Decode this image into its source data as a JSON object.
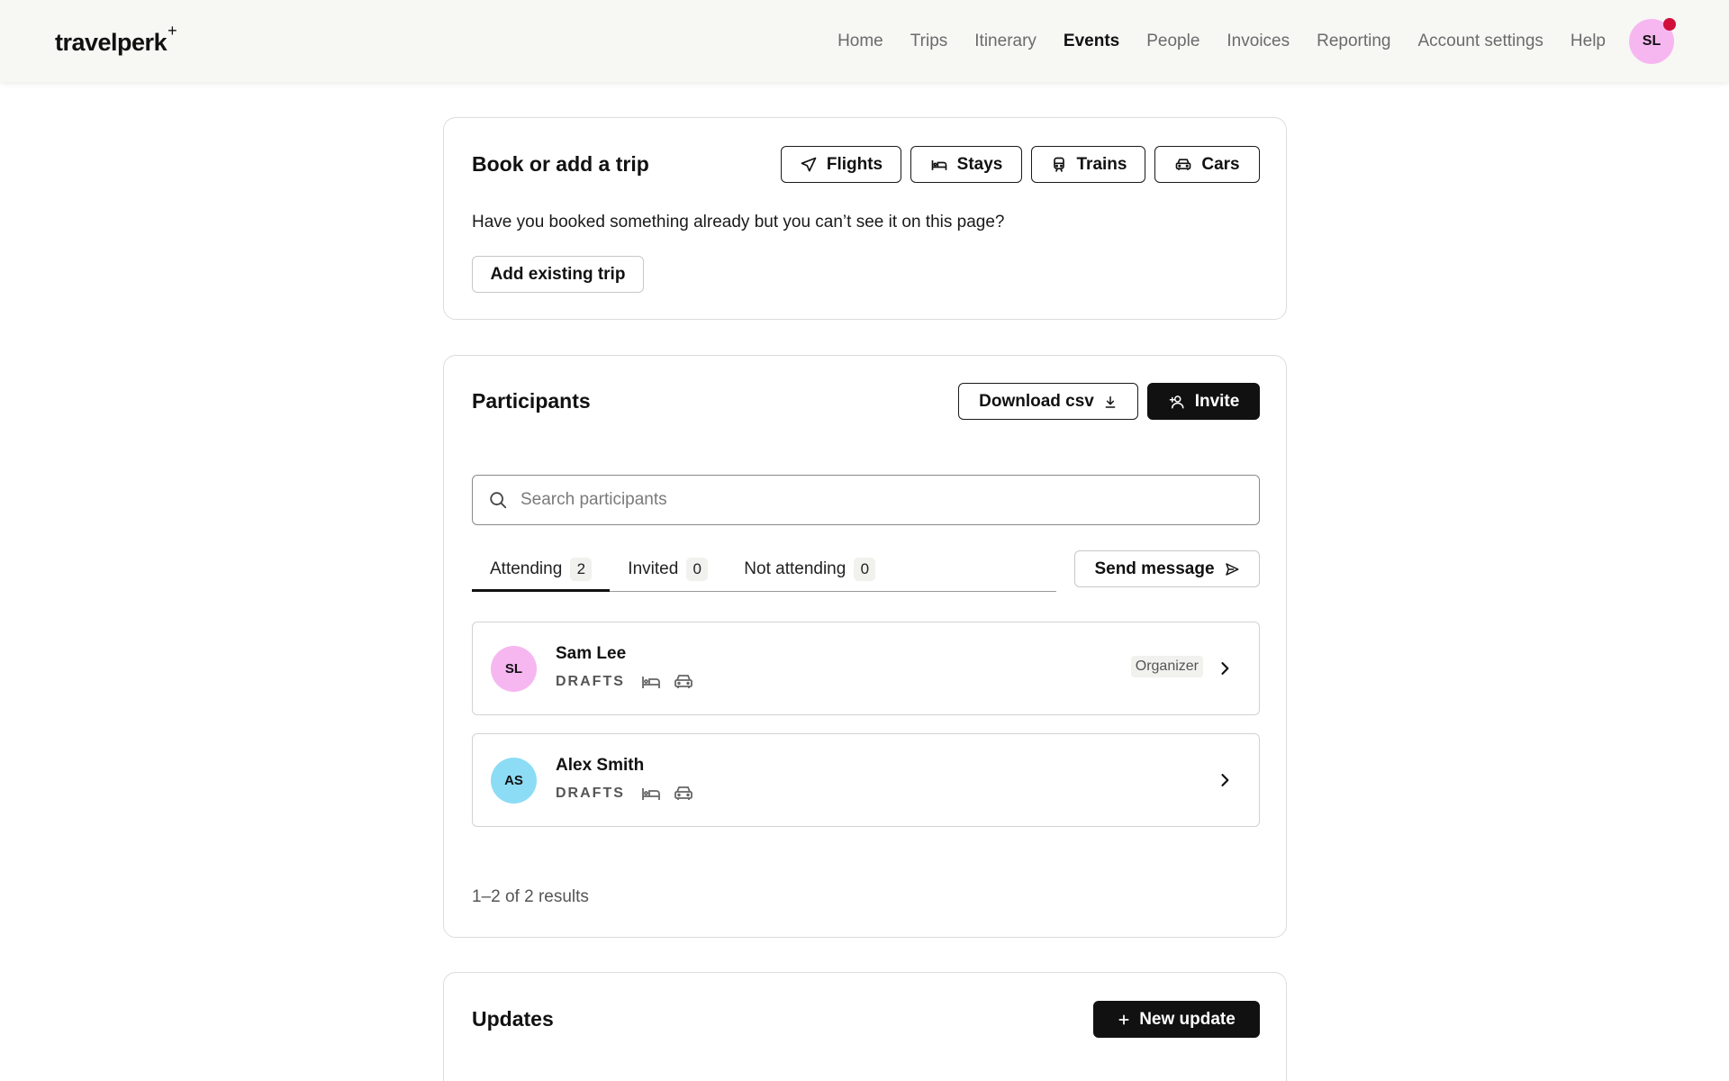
{
  "brand": {
    "name": "travelperk",
    "mark": "+"
  },
  "nav": {
    "items": [
      "Home",
      "Trips",
      "Itinerary",
      "Events",
      "People",
      "Invoices",
      "Reporting",
      "Account settings",
      "Help"
    ],
    "active": "Events",
    "user_initials": "SL"
  },
  "book": {
    "title": "Book or add a trip",
    "buttons": {
      "flights": "Flights",
      "stays": "Stays",
      "trains": "Trains",
      "cars": "Cars"
    },
    "prompt": "Have you booked something already but you can’t see it on this page?",
    "add_existing": "Add existing trip"
  },
  "participants": {
    "title": "Participants",
    "download_csv": "Download csv",
    "invite": "Invite",
    "search_placeholder": "Search participants",
    "tabs": [
      {
        "label": "Attending",
        "count": "2"
      },
      {
        "label": "Invited",
        "count": "0"
      },
      {
        "label": "Not attending",
        "count": "0"
      }
    ],
    "send_message": "Send message",
    "rows": [
      {
        "initials": "SL",
        "name": "Sam Lee",
        "status": "DRAFTS",
        "badge": "Organizer",
        "avatar_color": "#f6b7f0"
      },
      {
        "initials": "AS",
        "name": "Alex Smith",
        "status": "DRAFTS",
        "badge": "",
        "avatar_color": "#8ddcf5"
      }
    ],
    "results": "1–2 of 2 results"
  },
  "updates": {
    "title": "Updates",
    "new_update": "New update"
  },
  "icons": {
    "flights": "airplane-icon",
    "stays": "bed-icon",
    "trains": "train-icon",
    "cars": "car-icon",
    "download": "download-icon",
    "invite": "add-person-icon",
    "search": "search-icon",
    "send": "send-icon",
    "chevron": "chevron-right-icon",
    "plus": "plus-icon"
  },
  "colors": {
    "header_bg": "#f7f7f4",
    "primary_dark": "#111111",
    "notification": "#d0103a"
  }
}
